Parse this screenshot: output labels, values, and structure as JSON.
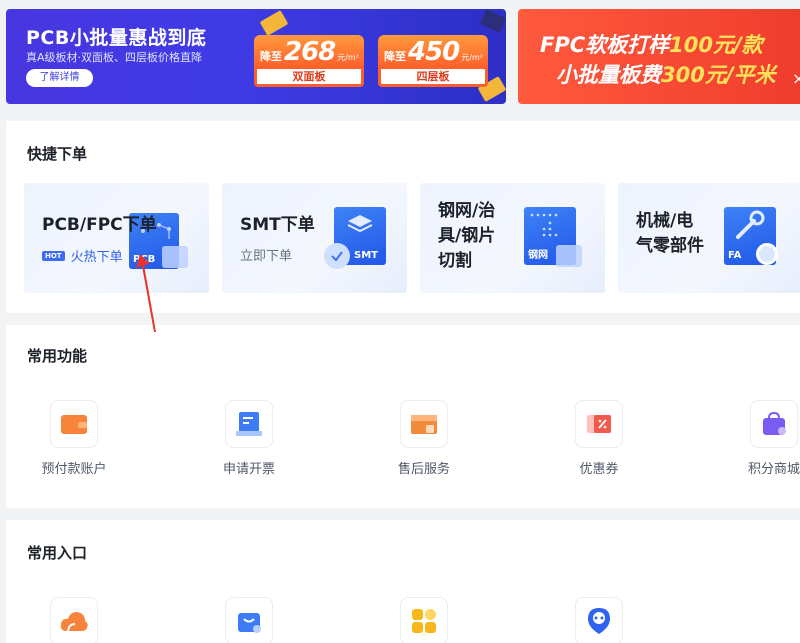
{
  "banners": {
    "pcb": {
      "title": "PCB小批量惠战到底",
      "subtitle": "真A级板材·双面板、四层板价格直降",
      "button": "了解详情",
      "deals": [
        {
          "prefix": "降至",
          "value": "268",
          "unit": "元/m²",
          "label": "双面板"
        },
        {
          "prefix": "降至",
          "value": "450",
          "unit": "元/m²",
          "label": "四层板"
        }
      ]
    },
    "fpc": {
      "line1_a": "FPC软板打样",
      "line1_b": "100元/款",
      "line2_a": "小批量板费",
      "line2_b": "300元/平米",
      "close": "×"
    }
  },
  "quick_order": {
    "title": "快捷下单",
    "cards": [
      {
        "title": "PCB/FPC下单",
        "hot_tag": "HOT",
        "sub": "火热下单",
        "icon_label": "PCB",
        "icon": "pcb-board-icon"
      },
      {
        "title": "SMT下单",
        "sub": "立即下单",
        "icon_label": "SMT",
        "icon": "smt-layers-icon"
      },
      {
        "title_l1": "钢网/治",
        "title_l2": "具/钢片",
        "title_l3": "切割",
        "icon_label": "钢网",
        "icon": "stencil-icon"
      },
      {
        "title_l1": "机械/电",
        "title_l2": "气零部件",
        "icon_label": "FA",
        "icon": "wrench-icon"
      }
    ]
  },
  "functions": {
    "title": "常用功能",
    "items": [
      {
        "label": "预付款账户",
        "icon": "wallet-icon",
        "color": "#f7843a"
      },
      {
        "label": "申请开票",
        "icon": "invoice-icon",
        "color": "#3d7cf5"
      },
      {
        "label": "售后服务",
        "icon": "service-box-icon",
        "color": "#f28a3c"
      },
      {
        "label": "优惠券",
        "icon": "coupon-icon",
        "color": "#f05a4f"
      },
      {
        "label": "积分商城",
        "icon": "shopping-bag-icon",
        "color": "#7b5cf0"
      }
    ]
  },
  "entries": {
    "title": "常用入口",
    "items": [
      {
        "icon": "cloud-icon",
        "color": "#f7843a"
      },
      {
        "icon": "bag-icon",
        "color": "#3d7cf5"
      },
      {
        "icon": "grid-apps-icon",
        "color": "#f8b81c"
      },
      {
        "icon": "location-pin-icon",
        "color": "#2f64f0"
      }
    ]
  }
}
